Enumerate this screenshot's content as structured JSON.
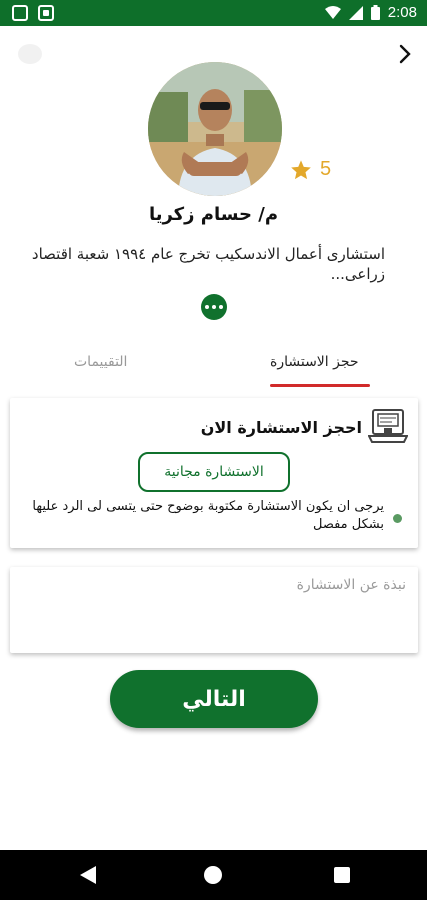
{
  "status_bar": {
    "time": "2:08"
  },
  "expert": {
    "name": "م/ حسام زكريا",
    "rating": "5",
    "bio": "استشارى أعمال الاندسكيب تخرج عام ١٩٩٤ شعبة اقتصاد زراعى..."
  },
  "tabs": [
    {
      "label": "حجز الاستشارة",
      "active": true
    },
    {
      "label": "التقييمات",
      "active": false
    }
  ],
  "booking_card": {
    "title": "احجز الاستشارة الان",
    "free_button": "الاستشارة مجانية",
    "note": "يرجى ان يكون الاستشارة مكتوبة بوضوح حتى يتسى لى الرد عليها بشكل مفصل"
  },
  "description_field": {
    "placeholder": "نبذة عن الاستشارة",
    "value": ""
  },
  "next_button": "التالي",
  "colors": {
    "primary": "#10712d",
    "status_bar": "#0e6f2a",
    "tab_indicator": "#d12a2a",
    "star": "#e3a82b"
  },
  "icons": [
    "back-chevron-icon",
    "star-icon",
    "more-dots-icon",
    "laptop-consult-icon",
    "nav-back-icon",
    "nav-home-icon",
    "nav-recent-icon"
  ]
}
